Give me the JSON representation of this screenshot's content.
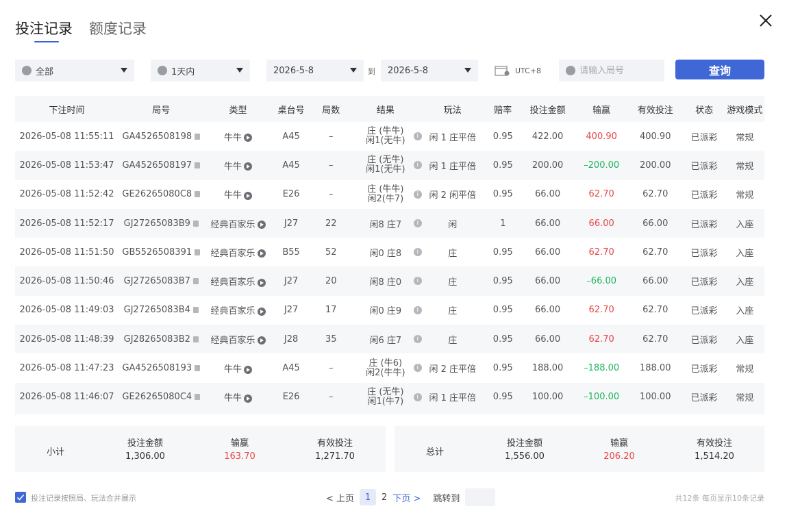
{
  "tabs": [
    {
      "label": "投注记录"
    },
    {
      "label": "额度记录"
    }
  ],
  "filters": {
    "game_type": "全部",
    "time_range": "1天内",
    "date_from": "2026-5-8",
    "date_to": "2026-5-8",
    "to_label": "到",
    "timezone": "UTC+8",
    "round_placeholder": "请输入局号",
    "query_label": "查询"
  },
  "table": {
    "columns": [
      "下注时间",
      "局号",
      "类型",
      "桌台号",
      "局数",
      "结果",
      "玩法",
      "赔率",
      "投注金额",
      "输赢",
      "有效投注",
      "状态",
      "游戏模式"
    ],
    "rows": [
      {
        "time": "2026-05-08 11:55:11",
        "round": "GA4526508198",
        "type": "牛牛",
        "table": "A45",
        "count": "–",
        "result1": "庄 (牛牛)",
        "result2": "闲1(无牛)",
        "play": "闲 1 庄平倍",
        "odds": "0.95",
        "bet": "422.00",
        "winloss": "400.90",
        "wl_color": "red",
        "valid": "400.90",
        "status": "已派彩",
        "mode": "常规"
      },
      {
        "time": "2026-05-08 11:53:47",
        "round": "GA4526508197",
        "type": "牛牛",
        "table": "A45",
        "count": "–",
        "result1": "庄 (无牛)",
        "result2": "闲1(无牛)",
        "play": "闲 1 庄平倍",
        "odds": "0.95",
        "bet": "200.00",
        "winloss": "–200.00",
        "wl_color": "green",
        "valid": "200.00",
        "status": "已派彩",
        "mode": "常规"
      },
      {
        "time": "2026-05-08 11:52:42",
        "round": "GE26265080C8",
        "type": "牛牛",
        "table": "E26",
        "count": "–",
        "result1": "庄 (牛牛)",
        "result2": "闲2(牛7)",
        "play": "闲 2 闲平倍",
        "odds": "0.95",
        "bet": "66.00",
        "winloss": "62.70",
        "wl_color": "red",
        "valid": "62.70",
        "status": "已派彩",
        "mode": "常规"
      },
      {
        "time": "2026-05-08 11:52:17",
        "round": "GJ27265083B9",
        "type": "经典百家乐",
        "table": "J27",
        "count": "22",
        "result1": "闲8 庄7",
        "result2": "",
        "play": "闲",
        "odds": "1",
        "bet": "66.00",
        "winloss": "66.00",
        "wl_color": "red",
        "valid": "66.00",
        "status": "已派彩",
        "mode": "入座"
      },
      {
        "time": "2026-05-08 11:51:50",
        "round": "GB5526508391",
        "type": "经典百家乐",
        "table": "B55",
        "count": "52",
        "result1": "闲0 庄8",
        "result2": "",
        "play": "庄",
        "odds": "0.95",
        "bet": "66.00",
        "winloss": "62.70",
        "wl_color": "red",
        "valid": "62.70",
        "status": "已派彩",
        "mode": "入座"
      },
      {
        "time": "2026-05-08 11:50:46",
        "round": "GJ27265083B7",
        "type": "经典百家乐",
        "table": "J27",
        "count": "20",
        "result1": "闲8 庄0",
        "result2": "",
        "play": "庄",
        "odds": "0.95",
        "bet": "66.00",
        "winloss": "–66.00",
        "wl_color": "green",
        "valid": "66.00",
        "status": "已派彩",
        "mode": "入座"
      },
      {
        "time": "2026-05-08 11:49:03",
        "round": "GJ27265083B4",
        "type": "经典百家乐",
        "table": "J27",
        "count": "17",
        "result1": "闲0 庄9",
        "result2": "",
        "play": "庄",
        "odds": "0.95",
        "bet": "66.00",
        "winloss": "62.70",
        "wl_color": "red",
        "valid": "62.70",
        "status": "已派彩",
        "mode": "入座"
      },
      {
        "time": "2026-05-08 11:48:39",
        "round": "GJ28265083B2",
        "type": "经典百家乐",
        "table": "J28",
        "count": "35",
        "result1": "闲6 庄7",
        "result2": "",
        "play": "庄",
        "odds": "0.95",
        "bet": "66.00",
        "winloss": "62.70",
        "wl_color": "red",
        "valid": "62.70",
        "status": "已派彩",
        "mode": "入座"
      },
      {
        "time": "2026-05-08 11:47:23",
        "round": "GA4526508193",
        "type": "牛牛",
        "table": "A45",
        "count": "–",
        "result1": "庄 (牛6)",
        "result2": "闲2(牛牛)",
        "play": "闲 2 庄平倍",
        "odds": "0.95",
        "bet": "188.00",
        "winloss": "–188.00",
        "wl_color": "green",
        "valid": "188.00",
        "status": "已派彩",
        "mode": "常规"
      },
      {
        "time": "2026-05-08 11:46:07",
        "round": "GE26265080C4",
        "type": "牛牛",
        "table": "E26",
        "count": "–",
        "result1": "庄 (无牛)",
        "result2": "闲1(牛7)",
        "play": "闲 1 庄平倍",
        "odds": "0.95",
        "bet": "100.00",
        "winloss": "–100.00",
        "wl_color": "green",
        "valid": "100.00",
        "status": "已派彩",
        "mode": "常规"
      }
    ]
  },
  "subtotal": {
    "label": "小计",
    "bet_label": "投注金额",
    "bet": "1,306.00",
    "wl_label": "输赢",
    "wl": "163.70",
    "valid_label": "有效投注",
    "valid": "1,271.70"
  },
  "total": {
    "label": "总计",
    "bet_label": "投注金额",
    "bet": "1,556.00",
    "wl_label": "输赢",
    "wl": "206.20",
    "valid_label": "有效投注",
    "valid": "1,514.20"
  },
  "footer": {
    "merge_label": "投注记录按照局、玩法合并展示",
    "prev_label": "< 上页",
    "pages": [
      "1",
      "2"
    ],
    "current_page": "1",
    "next_label": "下页 >",
    "jump_label": "跳转到",
    "total_info": "共12条  每页显示10条记录"
  },
  "colors": {
    "accent": "#3f68d6",
    "win": "#e64545",
    "loss": "#1cb35a"
  }
}
